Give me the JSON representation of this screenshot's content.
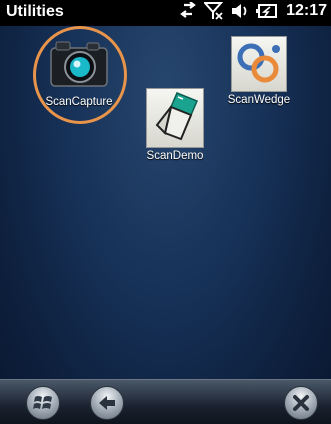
{
  "status_bar": {
    "title": "Utilities",
    "time": "12:17",
    "icons": [
      "sync-arrows-icon",
      "no-signal-icon",
      "speaker-icon",
      "battery-icon"
    ]
  },
  "apps": [
    {
      "label": "ScanCapture",
      "icon": "camera-icon",
      "highlighted": true
    },
    {
      "label": "ScanWedge",
      "icon": "scanwedge-rings-icon",
      "highlighted": false
    },
    {
      "label": "ScanDemo",
      "icon": "barcode-scanner-icon",
      "highlighted": false
    }
  ],
  "softbar": {
    "buttons": [
      "windows-start-icon",
      "back-arrow-icon",
      "close-icon"
    ]
  },
  "colors": {
    "background": "#163056",
    "highlight_ring": "#e8944a",
    "status_bar": "#000000"
  }
}
